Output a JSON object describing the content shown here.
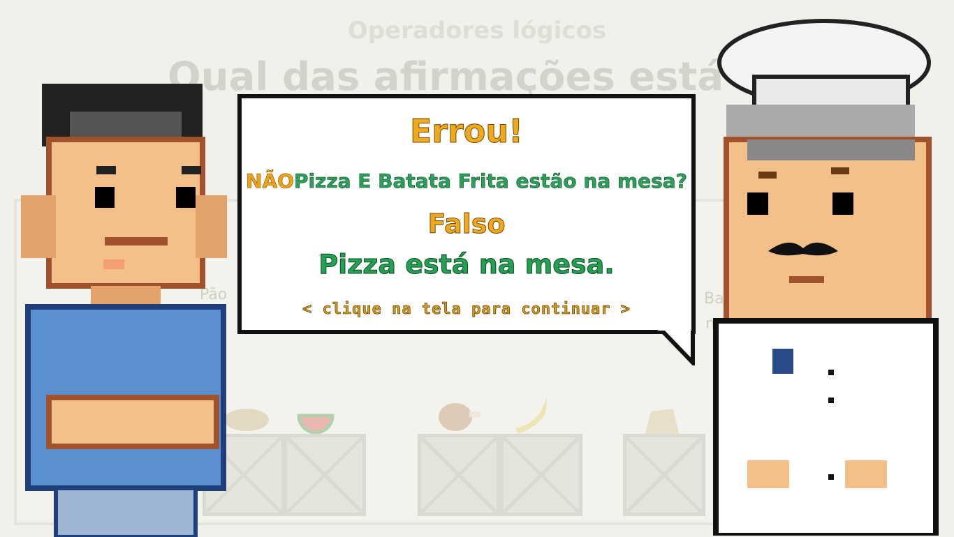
{
  "background": {
    "subtitle": "Operadores lógicos",
    "title": "Qual das afirmações está correta?",
    "options": [
      "Pão",
      "Batata Fr",
      "na mesa"
    ]
  },
  "dialog": {
    "result": "Errou!",
    "negation": "NÃO",
    "question": "Pizza E Batata Frita estão na mesa?",
    "answer": "Falso",
    "explanation": "Pizza está na mesa.",
    "continue_hint": "< clique na tela para continuar >"
  },
  "colors": {
    "result": "#f2a81c",
    "question": "#2ca05a",
    "negation": "#f0a315",
    "explanation": "#24a052",
    "bubble_border": "#111111",
    "player_shirt": "#5b8fd0",
    "chef_uniform": "#ffffff"
  },
  "icons": {
    "chef_badge": "logo-badge-icon"
  }
}
